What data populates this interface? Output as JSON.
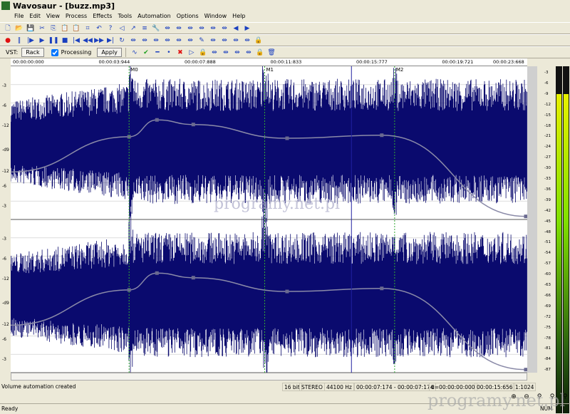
{
  "title": "Wavosaur - [buzz.mp3]",
  "menu": [
    "File",
    "Edit",
    "View",
    "Process",
    "Effects",
    "Tools",
    "Automation",
    "Options",
    "Window",
    "Help"
  ],
  "toolbar1": [
    "new-icon",
    "open-icon",
    "save-icon",
    "cut-icon",
    "copy-icon",
    "paste-icon",
    "paste-mix-icon",
    "crop-icon",
    "undo-icon",
    "help-icon",
    "speaker-icon",
    "route-icon",
    "settings-icon",
    "wrench-icon",
    "stretch-icon",
    "stretch2-icon",
    "zoom-sel-icon",
    "zoom-in-marker-icon",
    "zoom-out-marker-icon",
    "fit-icon",
    "left-arrow-icon",
    "right-arrow-icon"
  ],
  "toolbar2": [
    "record-icon",
    "pause-record-icon",
    "play-from-start-icon",
    "play-icon",
    "pause-icon",
    "stop-icon",
    "go-start-icon",
    "rewind-icon",
    "forward-icon",
    "go-end-icon",
    "loop-icon",
    "insert-icon",
    "spectrum-icon",
    "copy-window-icon",
    "normalize-icon",
    "eq-icon",
    "analyze-icon",
    "pencil-icon",
    "marker-icon",
    "marker-left-icon",
    "marker-right-icon",
    "silence-icon",
    "lock-icon"
  ],
  "vst": {
    "label": "VST:",
    "rack": "Rack",
    "processing": "Processing",
    "processing_checked": true,
    "apply": "Apply"
  },
  "toolbar3": [
    "envelope-icon",
    "check-icon",
    "line-icon",
    "point-icon",
    "delete-icon",
    "play-selection-icon",
    "lock-icon",
    "loop-start-icon",
    "loop-left-icon",
    "loop-right-icon",
    "loop-cut-icon",
    "lock2-icon",
    "trash-icon"
  ],
  "ruler": [
    {
      "t": 0,
      "label": "00:00:00:000"
    },
    {
      "t": 3.944,
      "label": "00:00:03:944"
    },
    {
      "t": 7.888,
      "label": "00:00:07:888"
    },
    {
      "t": 11.833,
      "label": "00:00:11:833"
    },
    {
      "t": 15.777,
      "label": "00:00:15:777"
    },
    {
      "t": 19.721,
      "label": "00:00:19:721"
    },
    {
      "t": 23.668,
      "label": "00:00:23:668"
    }
  ],
  "duration": 23.668,
  "markers": [
    {
      "label": "M0",
      "t": 5.44
    },
    {
      "label": "M1",
      "t": 11.67
    },
    {
      "label": "M2",
      "t": 17.64
    }
  ],
  "cursor_t": 15.656,
  "db_labels": [
    "-3",
    "-6",
    "-12",
    "-d9",
    "-12",
    "-6",
    "-3"
  ],
  "envelope": [
    {
      "t": 0,
      "level": 0.31
    },
    {
      "t": 5.44,
      "level": 0.54
    },
    {
      "t": 6.72,
      "level": 0.65
    },
    {
      "t": 8.39,
      "level": 0.62
    },
    {
      "t": 12.7,
      "level": 0.53
    },
    {
      "t": 17.05,
      "level": 0.55
    },
    {
      "t": 23.668,
      "level": 0.02
    }
  ],
  "meter_labels": [
    "-3",
    "-6",
    "-9",
    "-12",
    "-15",
    "-18",
    "-21",
    "-24",
    "-27",
    "-30",
    "-33",
    "-36",
    "-39",
    "-42",
    "-45",
    "-48",
    "-51",
    "-54",
    "-57",
    "-60",
    "-63",
    "-66",
    "-69",
    "-72",
    "-75",
    "-78",
    "-81",
    "-84",
    "-87"
  ],
  "meter_level_db": -6,
  "status": {
    "message": "Volume automation created",
    "bits": "16 bit",
    "channels": "STEREO",
    "rate": "44100 Hz",
    "selection": "00:00:07:174 - 00:00:07:174",
    "delta": "d=00:00:00:000",
    "position": "00:00:15:656",
    "zoom": "1:1024",
    "ready": "Ready",
    "num": "NUM"
  },
  "watermark": "programy.net.pl",
  "colors": {
    "wave": "#0a0a6e",
    "envelope": "#8a8aa8",
    "marker": "#33aa33",
    "cursor": "#2020a0"
  }
}
